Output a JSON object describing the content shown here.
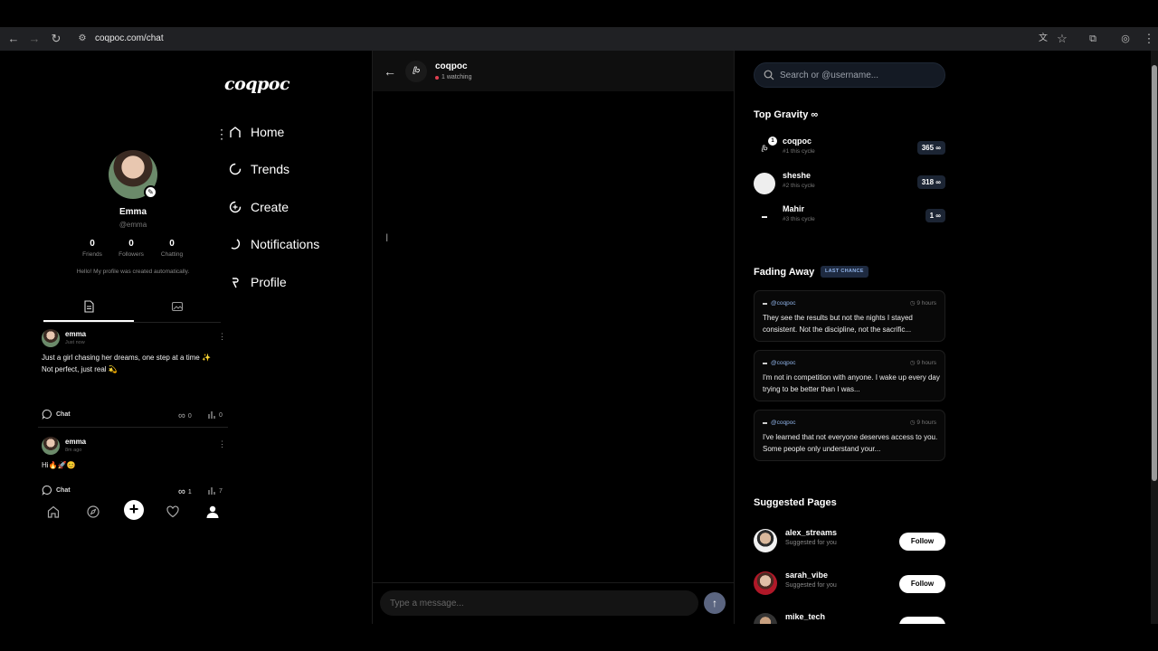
{
  "browser": {
    "url": "coqpoc.com/chat"
  },
  "app": {
    "logo": "coqpoc"
  },
  "nav": {
    "items": [
      {
        "label": "Home",
        "icon": "home-icon"
      },
      {
        "label": "Trends",
        "icon": "trends-icon"
      },
      {
        "label": "Create",
        "icon": "create-icon"
      },
      {
        "label": "Notifications",
        "icon": "bell-icon"
      },
      {
        "label": "Profile",
        "icon": "user-icon"
      }
    ]
  },
  "profile": {
    "name": "Emma",
    "username": "@emma",
    "stats": [
      {
        "value": "0",
        "label": "Friends"
      },
      {
        "value": "0",
        "label": "Followers"
      },
      {
        "value": "0",
        "label": "Chatting"
      }
    ],
    "bio": "Hello! My profile was created automatically."
  },
  "posts": [
    {
      "author": "emma",
      "time": "Just now",
      "text": "Just a girl chasing her dreams, one step at a time ✨\nNot perfect, just real 💫",
      "chat_label": "Chat",
      "gravity": "0",
      "views": "0"
    },
    {
      "author": "emma",
      "time": "8m ago",
      "text": "Hi🔥🚀😊",
      "chat_label": "Chat",
      "gravity": "1",
      "views": "7"
    }
  ],
  "chat": {
    "name": "coqpoc",
    "avatar_text": "ᥫᩣ",
    "watching": "1 watching",
    "input_placeholder": "Type a message..."
  },
  "search": {
    "placeholder": "Search or @username..."
  },
  "top_gravity": {
    "title": "Top Gravity ∞",
    "items": [
      {
        "name": "coqpoc",
        "sub": "#1 this cycle",
        "score": "365 ∞",
        "badge": "1"
      },
      {
        "name": "sheshe",
        "sub": "#2 this cycle",
        "score": "318 ∞"
      },
      {
        "name": "Mahir",
        "sub": "#3 this cycle",
        "score": "1 ∞"
      }
    ]
  },
  "fading": {
    "title": "Fading Away",
    "badge": "LAST CHANCE",
    "items": [
      {
        "user": "@coqpoc",
        "time": "9 hours",
        "text": "They see the results but not the nights I stayed consistent. Not the discipline, not the sacrific..."
      },
      {
        "user": "@coqpoc",
        "time": "9 hours",
        "text": "I'm not in competition with anyone. I wake up every day trying to be better than I was..."
      },
      {
        "user": "@coqpoc",
        "time": "9 hours",
        "text": "I've learned that not everyone deserves access to you. Some people only understand your..."
      }
    ]
  },
  "suggested": {
    "title": "Suggested Pages",
    "items": [
      {
        "name": "alex_streams",
        "sub": "Suggested for you",
        "button": "Follow"
      },
      {
        "name": "sarah_vibe",
        "sub": "Suggested for you",
        "button": "Follow"
      },
      {
        "name": "mike_tech",
        "sub": "",
        "button": ""
      }
    ]
  },
  "colors": {
    "background": "#000000",
    "accent": "#8fb2e8",
    "live_dot": "#e04050",
    "send_button": "#5b6580"
  }
}
